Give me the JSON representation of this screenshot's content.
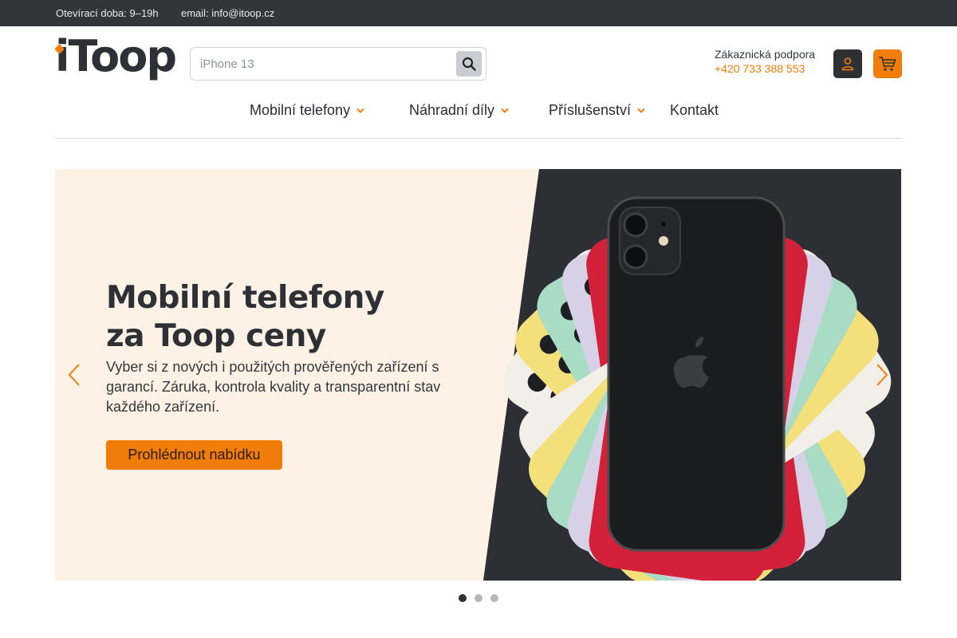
{
  "topbar": {
    "hours": "Otevírací doba: 9–19h",
    "email": "email: info@itoop.cz"
  },
  "header": {
    "logo_text": "iToop",
    "search": {
      "placeholder": "iPhone 13",
      "icon": "search-icon"
    },
    "support": {
      "label": "Zákaznická podpora",
      "phone": "+420 733 388 553"
    },
    "user_icon": "user-icon",
    "cart_icon": "cart-icon"
  },
  "nav": {
    "items": [
      {
        "label": "Mobilní telefony",
        "has_dropdown": true
      },
      {
        "label": "Náhradní díly",
        "has_dropdown": true
      },
      {
        "label": "Příslušenství",
        "has_dropdown": true
      },
      {
        "label": "Kontakt",
        "has_dropdown": false
      }
    ]
  },
  "hero": {
    "title_line1": "Mobilní telefony",
    "title_line2": "za Toop ceny",
    "text": "Vyber si z nových i použitých prověřených zařízení s garancí. Záruka, kontrola kvality a transparentní stav každého zařízení.",
    "cta": "Prohlédnout nabídku",
    "slides_total": 3,
    "active_slide": 1
  },
  "colors": {
    "accent": "#f07d0a",
    "dark": "#2d3035",
    "topbar": "#32363b",
    "hero_bg": "#fef2e6"
  }
}
